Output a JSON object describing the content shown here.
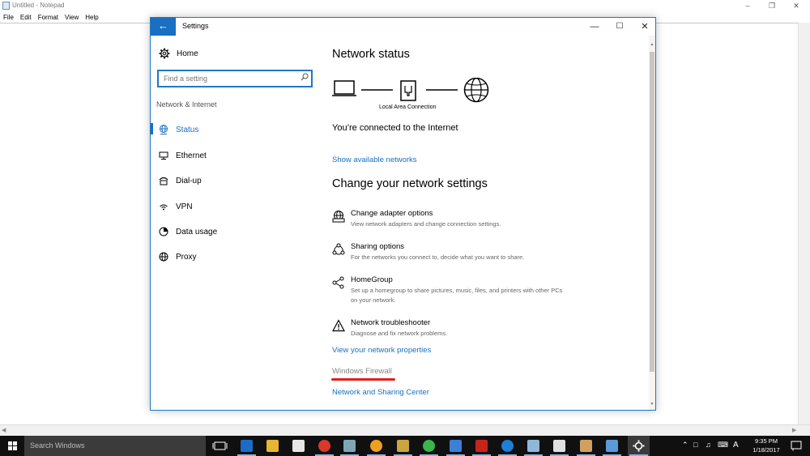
{
  "notepad": {
    "title": "Untitled - Notepad",
    "menu": [
      "File",
      "Edit",
      "Format",
      "View",
      "Help"
    ]
  },
  "settings": {
    "title": "Settings",
    "sidebar": {
      "home_label": "Home",
      "search_placeholder": "Find a setting",
      "section_label": "Network & Internet",
      "items": [
        {
          "label": "Status",
          "icon": "globe-icon",
          "active": true
        },
        {
          "label": "Ethernet",
          "icon": "ethernet-icon",
          "active": false
        },
        {
          "label": "Dial-up",
          "icon": "dialup-icon",
          "active": false
        },
        {
          "label": "VPN",
          "icon": "vpn-icon",
          "active": false
        },
        {
          "label": "Data usage",
          "icon": "data-usage-icon",
          "active": false
        },
        {
          "label": "Proxy",
          "icon": "proxy-icon",
          "active": false
        }
      ]
    },
    "main": {
      "status_heading": "Network status",
      "connection_label": "Local Area Connection",
      "connected_text": "You’re connected to the Internet",
      "show_networks_link": "Show available networks",
      "change_heading": "Change your network settings",
      "options": [
        {
          "title": "Change adapter options",
          "desc": "View network adapters and change connection settings.",
          "icon": "adapter-icon"
        },
        {
          "title": "Sharing options",
          "desc": "For the networks you connect to, decide what you want to share.",
          "icon": "sharing-icon"
        },
        {
          "title": "HomeGroup",
          "desc": "Set up a homegroup to share pictures, music, files, and printers with other PCs on your network.",
          "icon": "homegroup-icon"
        },
        {
          "title": "Network troubleshooter",
          "desc": "Diagnose and fix network problems.",
          "icon": "warning-icon"
        }
      ],
      "properties_link": "View your network properties",
      "firewall_link": "Windows Firewall",
      "sharing_center_link": "Network and Sharing Center"
    },
    "accent_color": "#1a6fc1",
    "annotation_color": "#e0201a"
  },
  "taskbar": {
    "search_text": "Search Windows",
    "time": "9:35 PM",
    "date": "1/18/2017",
    "ime_label": "A"
  }
}
